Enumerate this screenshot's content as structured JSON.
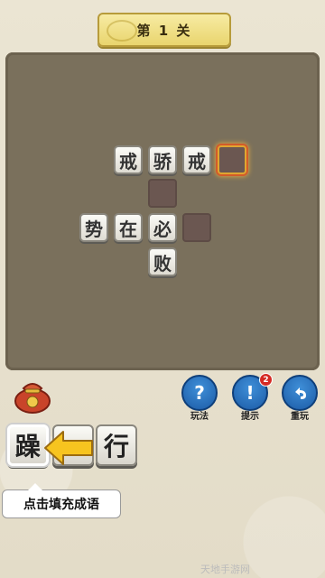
{
  "header": {
    "level_title": "第 1 关"
  },
  "board": {
    "tiles": [
      {
        "char": "戒"
      },
      {
        "char": "骄"
      },
      {
        "char": "戒"
      },
      {
        "char": "势"
      },
      {
        "char": "在"
      },
      {
        "char": "必"
      },
      {
        "char": "败"
      }
    ]
  },
  "controls": {
    "play_label": "玩法",
    "hint_label": "提示",
    "hint_badge": "2",
    "replay_label": "重玩"
  },
  "choices": [
    {
      "char": "躁"
    },
    {
      "char": ""
    },
    {
      "char": "行"
    }
  ],
  "tooltip": "点击填充成语",
  "watermark": "天地手游网",
  "colors": {
    "accent_blue": "#1c5ba6",
    "badge_red": "#d52a24",
    "title_gold": "#e9d56e"
  }
}
